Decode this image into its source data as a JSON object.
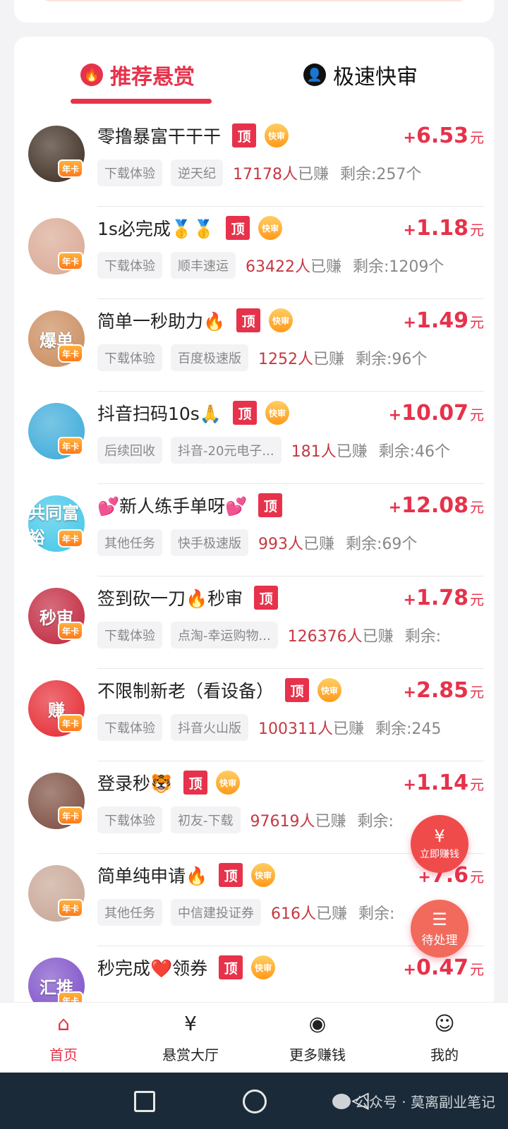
{
  "tabs": [
    {
      "label": "推荐悬赏",
      "icon": "fire-icon",
      "active": true
    },
    {
      "label": "极速快审",
      "icon": "user-icon",
      "active": false
    }
  ],
  "badges": {
    "top": "顶",
    "fast_review": "快审",
    "annual_card": "年卡"
  },
  "currency": "元",
  "tasks": [
    {
      "title": "零撸暴富干干干",
      "has_top": true,
      "has_fast": true,
      "sign": "+",
      "amount": "6.53",
      "tags": [
        "下载体验",
        "逆天纪"
      ],
      "earned_count": "17178人",
      "earned_suffix": "已赚",
      "remaining": "剩余:257个",
      "avatar_text": "",
      "avatar_color": "#3b2a1e"
    },
    {
      "title": "1s必完成🥇🥇",
      "has_top": true,
      "has_fast": true,
      "sign": "+",
      "amount": "1.18",
      "tags": [
        "下载体验",
        "顺丰速运"
      ],
      "earned_count": "63422人",
      "earned_suffix": "已赚",
      "remaining": "剩余:1209个",
      "avatar_text": "",
      "avatar_color": "#d9a792"
    },
    {
      "title": "简单一秒助力🔥",
      "has_top": true,
      "has_fast": true,
      "sign": "+",
      "amount": "1.49",
      "tags": [
        "下载体验",
        "百度极速版"
      ],
      "earned_count": "1252人",
      "earned_suffix": "已赚",
      "remaining": "剩余:96个",
      "avatar_text": "爆单",
      "avatar_color": "#c98a5a"
    },
    {
      "title": "抖音扫码10s🙏",
      "has_top": true,
      "has_fast": true,
      "sign": "+",
      "amount": "10.07",
      "tags": [
        "后续回收",
        "抖音-20元电子..."
      ],
      "earned_count": "181人",
      "earned_suffix": "已赚",
      "remaining": "剩余:46个",
      "avatar_text": "",
      "avatar_color": "#37a9d8"
    },
    {
      "title": "💕新人练手单呀💕",
      "has_top": true,
      "has_fast": false,
      "sign": "+",
      "amount": "12.08",
      "tags": [
        "其他任务",
        "快手极速版"
      ],
      "earned_count": "993人",
      "earned_suffix": "已赚",
      "remaining": "剩余:69个",
      "avatar_text": "共同富裕",
      "avatar_color": "#3ec6e8"
    },
    {
      "title": "签到砍一刀🔥秒审",
      "has_top": true,
      "has_fast": false,
      "sign": "+",
      "amount": "1.78",
      "tags": [
        "下载体验",
        "点淘-幸运购物..."
      ],
      "earned_count": "126376人",
      "earned_suffix": "已赚",
      "remaining": "剩余:",
      "avatar_text": "秒审",
      "avatar_color": "#c0233a"
    },
    {
      "title": "不限制新老（看设备）",
      "has_top": true,
      "has_fast": true,
      "sign": "+",
      "amount": "2.85",
      "tags": [
        "下载体验",
        "抖音火山版"
      ],
      "earned_count": "100311人",
      "earned_suffix": "已赚",
      "remaining": "剩余:245",
      "avatar_text": "赚",
      "avatar_color": "#e5262f"
    },
    {
      "title": "登录秒🐯",
      "has_top": true,
      "has_fast": true,
      "sign": "+",
      "amount": "1.14",
      "tags": [
        "下载体验",
        "初友-下载"
      ],
      "earned_count": "97619人",
      "earned_suffix": "已赚",
      "remaining": "剩余:",
      "avatar_text": "",
      "avatar_color": "#7a4a3c"
    },
    {
      "title": "简单纯申请🔥",
      "has_top": true,
      "has_fast": true,
      "sign": "+",
      "amount": "7.6",
      "tags": [
        "其他任务",
        "中信建投证券"
      ],
      "earned_count": "616人",
      "earned_suffix": "已赚",
      "remaining": "剩余:",
      "avatar_text": "",
      "avatar_color": "#c7a493"
    },
    {
      "title": "秒完成❤️领券",
      "has_top": true,
      "has_fast": true,
      "sign": "+",
      "amount": "0.47",
      "tags": [],
      "earned_count": "",
      "earned_suffix": "",
      "remaining": "",
      "avatar_text": "汇推",
      "avatar_color": "#7b4cc7"
    }
  ],
  "floating": {
    "earn_now": "立即赚钱",
    "earn_icon": "¥",
    "pending": "待处理"
  },
  "bottom_nav": [
    {
      "label": "首页",
      "icon": "home-icon",
      "active": true
    },
    {
      "label": "悬赏大厅",
      "icon": "reward-hall-icon",
      "active": false
    },
    {
      "label": "更多赚钱",
      "icon": "gamepad-icon",
      "active": false
    },
    {
      "label": "我的",
      "icon": "profile-icon",
      "active": false
    }
  ],
  "watermark": "公众号 · 莫离副业笔记",
  "colors": {
    "accent": "#e6324b",
    "badge_orange": "#ff9a1a",
    "system_bar": "#1a2a38"
  }
}
